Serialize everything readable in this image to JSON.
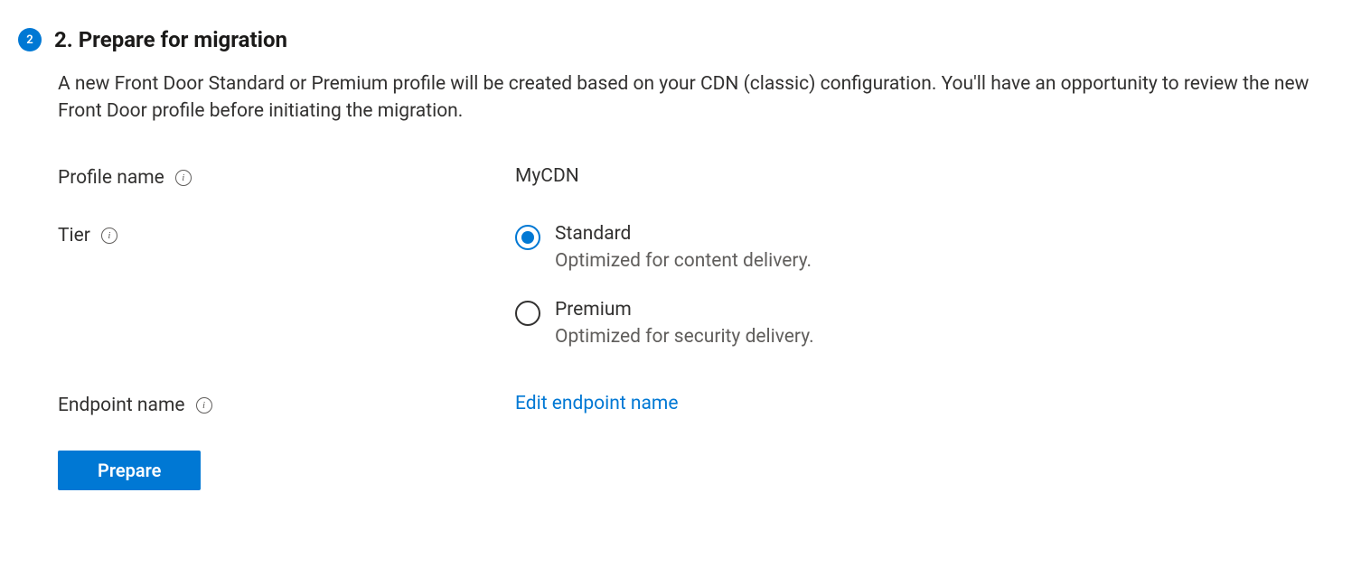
{
  "step": {
    "number": "2",
    "title": "2. Prepare for migration",
    "description": "A new Front Door Standard or Premium profile will be created based on your CDN (classic) configuration. You'll have an opportunity to review the new Front Door profile before initiating the migration."
  },
  "form": {
    "profile_name": {
      "label": "Profile name",
      "value": "MyCDN"
    },
    "tier": {
      "label": "Tier",
      "options": [
        {
          "label": "Standard",
          "description": "Optimized for content delivery.",
          "selected": true
        },
        {
          "label": "Premium",
          "description": "Optimized for security delivery.",
          "selected": false
        }
      ]
    },
    "endpoint_name": {
      "label": "Endpoint name",
      "link_text": "Edit endpoint name"
    }
  },
  "actions": {
    "prepare_label": "Prepare"
  }
}
